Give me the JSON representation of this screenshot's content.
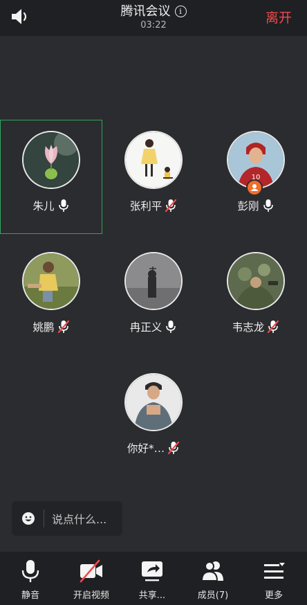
{
  "header": {
    "speaker_icon": "speaker-icon",
    "title": "腾讯会议",
    "info_symbol": "i",
    "timer": "03:22",
    "leave_label": "离开",
    "leave_color": "#f04a4a"
  },
  "participants": [
    {
      "name": "朱儿",
      "mic": "on",
      "active": true
    },
    {
      "name": "张利平",
      "mic": "muted"
    },
    {
      "name": "彭刚",
      "mic": "on",
      "host_badge": true
    },
    {
      "name": "姚鹏",
      "mic": "muted"
    },
    {
      "name": "冉正义",
      "mic": "on"
    },
    {
      "name": "韦志龙",
      "mic": "muted"
    },
    {
      "name": "你好*…",
      "mic": "muted"
    }
  ],
  "chat": {
    "placeholder": "说点什么..."
  },
  "toolbar": {
    "mute_label": "静音",
    "video_label": "开启视频",
    "share_label": "共享...",
    "members_label": "成员(7)",
    "more_label": "更多"
  },
  "colors": {
    "background": "#2b2c2f",
    "bars": "#1f2023",
    "active_border": "#2ea65a",
    "mic_on": "#ffffff",
    "mic_muted_slash": "#f04a4a",
    "video_slash": "#f04a4a",
    "host_badge": "#f06d2c"
  }
}
